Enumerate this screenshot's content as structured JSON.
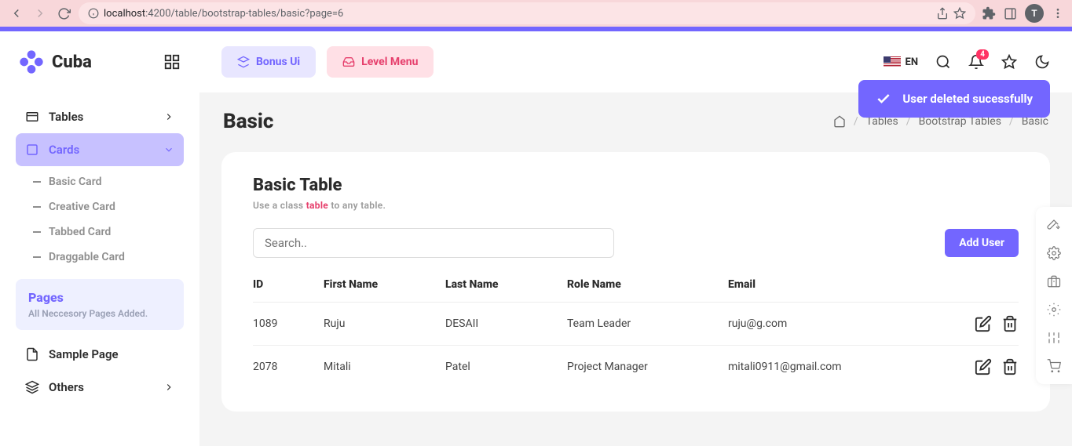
{
  "browser": {
    "url_host": "localhost",
    "url_port": ":4200",
    "url_path": "/table/bootstrap-tables/basic?page=6",
    "avatar": "T"
  },
  "brand": {
    "name": "Cuba"
  },
  "sidebar": {
    "tables_label": "Tables",
    "cards_label": "Cards",
    "cards_children": [
      "Basic Card",
      "Creative Card",
      "Tabbed Card",
      "Draggable Card"
    ],
    "pages_title": "Pages",
    "pages_sub": "All Neccesory Pages Added.",
    "sample_page": "Sample Page",
    "others": "Others"
  },
  "topbar": {
    "bonus_ui": "Bonus Ui",
    "level_menu": "Level Menu",
    "lang": "EN",
    "bell_badge": "4"
  },
  "toast": {
    "msg": "User deleted sucessfully"
  },
  "page": {
    "title": "Basic",
    "breadcrumb": [
      "Tables",
      "Bootstrap Tables",
      "Basic"
    ]
  },
  "card": {
    "title": "Basic Table",
    "desc_pre": "Use a class",
    "desc_code": "table",
    "desc_post": "to any table.",
    "search_placeholder": "Search..",
    "add_user": "Add User",
    "columns": [
      "ID",
      "First Name",
      "Last Name",
      "Role Name",
      "Email"
    ],
    "rows": [
      {
        "id": "1089",
        "first": "Ruju",
        "last": "DESAII",
        "role": "Team Leader",
        "email": "ruju@g.com"
      },
      {
        "id": "2078",
        "first": "Mitali",
        "last": "Patel",
        "role": "Project Manager",
        "email": "mitali0911@gmail.com"
      }
    ]
  }
}
